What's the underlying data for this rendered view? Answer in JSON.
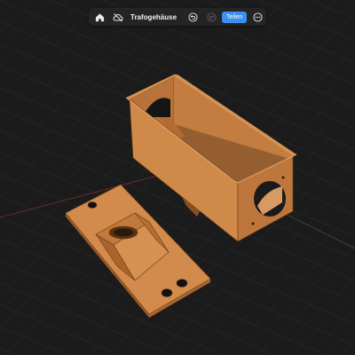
{
  "toolbar": {
    "title": "Trafogehäuse",
    "share_label": "Teilen",
    "icons": {
      "home": "home-icon",
      "cloud": "cloud-off-icon",
      "undo": "undo-icon",
      "redo": "redo-icon",
      "more": "more-icon"
    },
    "redo_enabled": false
  },
  "colors": {
    "background": "#1b1b1c",
    "grid": "#2b2b2d",
    "model": "#cf894a",
    "accent": "#3a8ff0"
  }
}
